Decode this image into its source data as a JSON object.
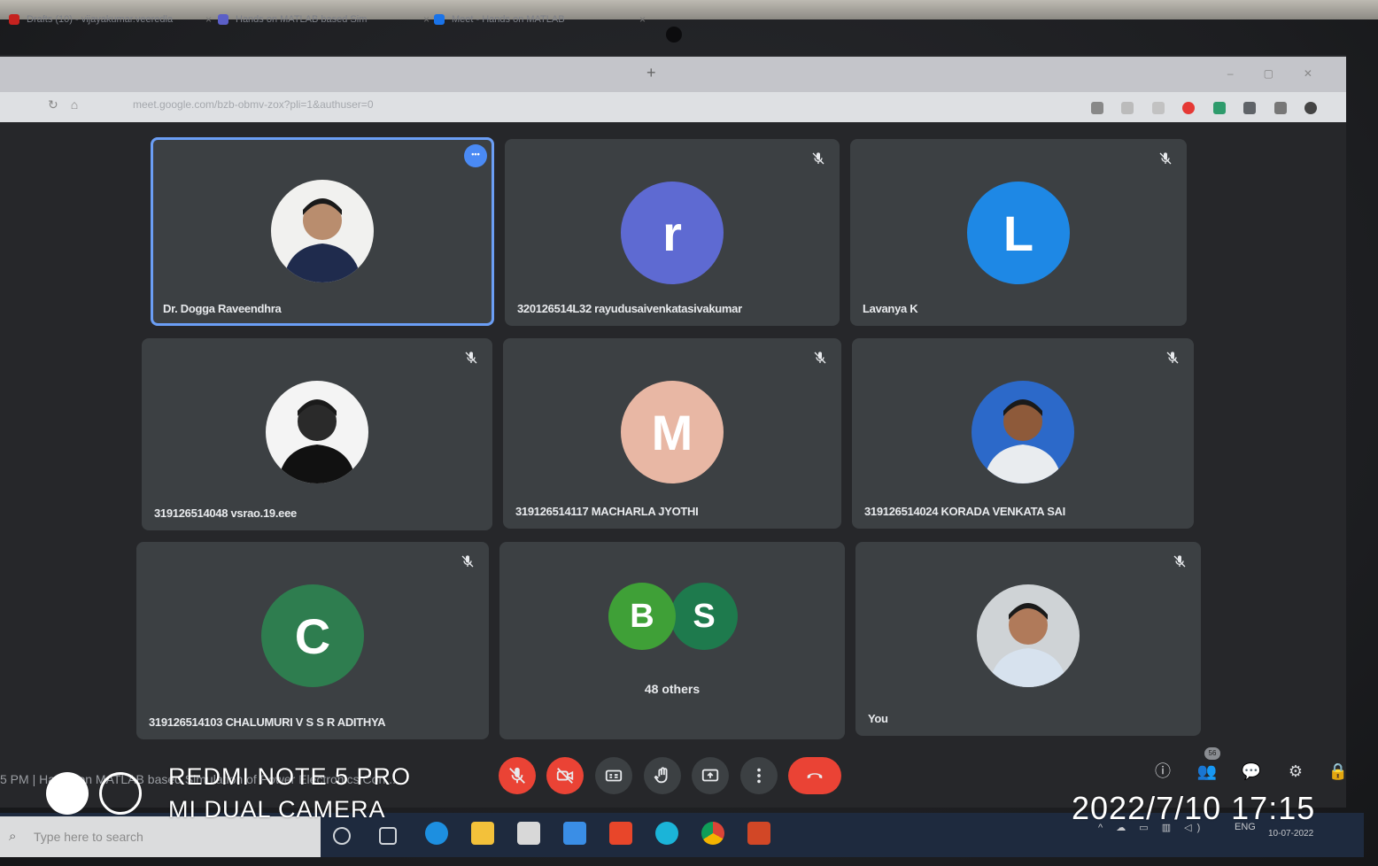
{
  "browser": {
    "tabs": [
      {
        "label": "Drafts (10) - vijayakumar.veeredla",
        "color": "#c5221f"
      },
      {
        "label": "Hands on MATLAB based Sim",
        "color": "#5b5fc7"
      },
      {
        "label": "Meet - Hands on MATLAB",
        "color": "#1a73e8"
      }
    ],
    "new_tab": "+",
    "url": "meet.google.com/bzb-obmv-zox?pli=1&authuser=0"
  },
  "tiles": [
    {
      "name": "Dr. Dogga Raveendhra",
      "type": "photo",
      "active": true,
      "muted": false,
      "photo_skin": "#b98d6e",
      "photo_bg": "#f1f1ef",
      "photo_shirt": "#1f2b4d"
    },
    {
      "name": "320126514L32 rayudusaivenkatasivakumar",
      "type": "letter",
      "letter": "r",
      "color": "#5e6ad2",
      "muted": true
    },
    {
      "name": "Lavanya K",
      "type": "letter",
      "letter": "L",
      "color": "#1e88e5",
      "muted": true
    },
    {
      "name": "319126514048 vsrao.19.eee",
      "type": "photo",
      "active": false,
      "muted": true,
      "photo_skin": "#2a2a2a",
      "photo_bg": "#f4f4f4",
      "photo_shirt": "#111111"
    },
    {
      "name": "319126514117 MACHARLA JYOTHI",
      "type": "letter",
      "letter": "M",
      "color": "#e8b7a4",
      "muted": true
    },
    {
      "name": "319126514024 KORADA VENKATA SAI",
      "type": "photo",
      "active": false,
      "muted": true,
      "photo_skin": "#8e5a3a",
      "photo_bg": "#2c69c9",
      "photo_shirt": "#e9ecef"
    },
    {
      "name": "319126514103 CHALUMURI V S S R ADITHYA",
      "type": "letter",
      "letter": "C",
      "color": "#2e7d4f",
      "muted": true
    },
    {
      "name": "",
      "type": "others",
      "letters": [
        {
          "letter": "B",
          "color": "#3fa037"
        },
        {
          "letter": "S",
          "color": "#1e7a4d"
        }
      ],
      "label": "48 others",
      "muted": false
    },
    {
      "name": "You",
      "type": "photo",
      "active": false,
      "muted": true,
      "photo_skin": "#b07a5a",
      "photo_bg": "#cfd3d6",
      "photo_shirt": "#d7e2ee"
    }
  ],
  "meeting_left": "5 PM  |  Hands on MATLAB based Simulation of Power Electronics Con...",
  "controls": [
    {
      "id": "mic",
      "icon": "mic-off-icon",
      "red": true
    },
    {
      "id": "camera",
      "icon": "camera-off-icon",
      "red": true
    },
    {
      "id": "captions",
      "icon": "captions-icon",
      "red": false
    },
    {
      "id": "raise-hand",
      "icon": "hand-icon",
      "red": false
    },
    {
      "id": "present",
      "icon": "present-icon",
      "red": false
    },
    {
      "id": "more",
      "icon": "more-vert-icon",
      "red": false
    },
    {
      "id": "leave",
      "icon": "phone-hangup-icon",
      "red": true
    }
  ],
  "people_count": "56",
  "taskbar": {
    "search_placeholder": "Type here to search",
    "tray_lang": "ENG",
    "tray_date": "10-07-2022"
  },
  "watermark": {
    "line1": "REDMI NOTE 5 PRO",
    "line2": "MI DUAL CAMERA",
    "stamp": "2022/7/10  17:15"
  },
  "colors": {
    "tile_bg": "#3c4043",
    "active_border": "#6b9ef5",
    "danger": "#ea4335"
  }
}
